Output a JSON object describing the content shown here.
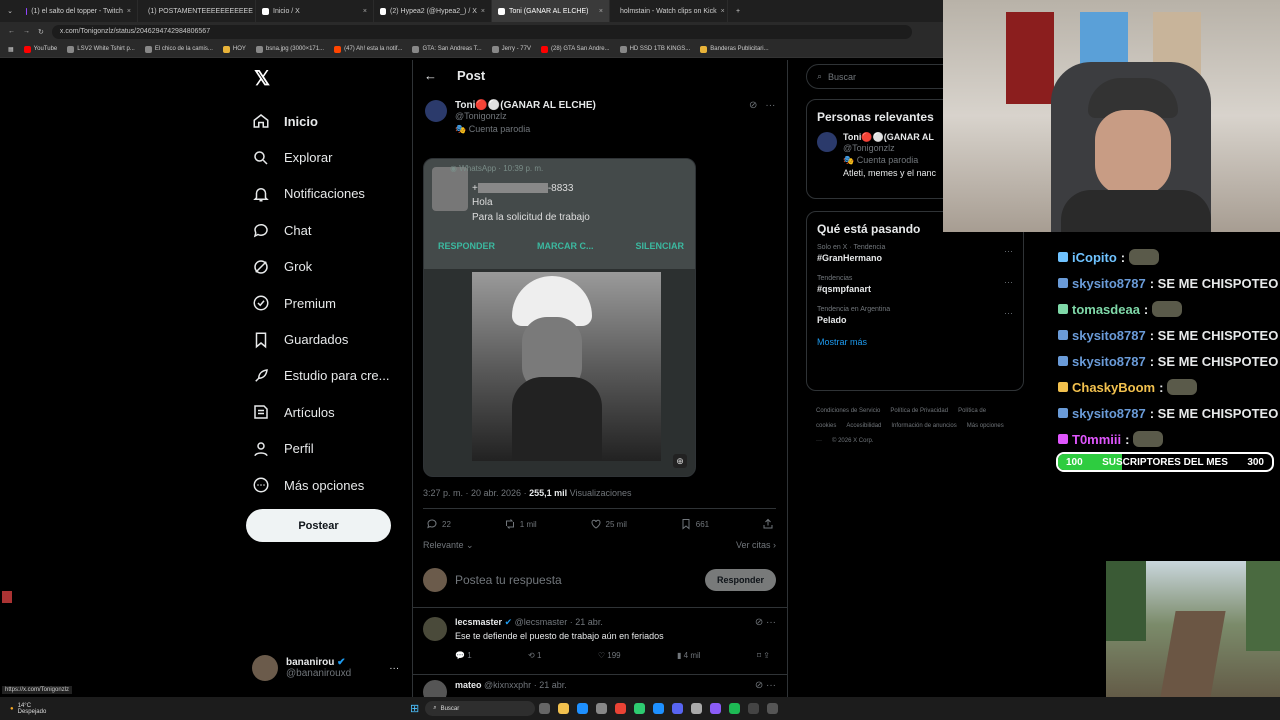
{
  "browser": {
    "tabs": [
      {
        "label": "(1) el salto del topper - Twitch",
        "color": "#9146ff"
      },
      {
        "label": "(1) POSTAMENTEEEEEEEEEEE",
        "color": "#9146ff"
      },
      {
        "label": "Inicio / X",
        "color": "#ffffff"
      },
      {
        "label": "(2) Hypea2 (@Hypea2_) / X",
        "color": "#ffffff"
      },
      {
        "label": "Toni (GANAR AL ELCHE)",
        "color": "#ffffff",
        "active": true
      },
      {
        "label": "holmstain - Watch clips on Kick",
        "color": "#53fc18"
      }
    ],
    "new_tab": "+",
    "url": "x.com/Tonigonzlz/status/2046294742984806567",
    "bookmarks": [
      {
        "label": "YouTube",
        "color": "#ff0000"
      },
      {
        "label": "LSV2 White Tshirt p...",
        "color": "#888888"
      },
      {
        "label": "El chico de la camis...",
        "color": "#888888"
      },
      {
        "label": "HOY",
        "color": "#e8b339"
      },
      {
        "label": "bsna.jpg (3000×171...",
        "color": "#888888"
      },
      {
        "label": "(47) Ah! esta la notif...",
        "color": "#ff4500"
      },
      {
        "label": "GTA: San Andreas T...",
        "color": "#888888"
      },
      {
        "label": "Jerry - 77V",
        "color": "#888888"
      },
      {
        "label": "(28) GTA San Andre...",
        "color": "#ff0000"
      },
      {
        "label": "HD SSD 1TB KINGS...",
        "color": "#888888"
      },
      {
        "label": "Banderas Publicitari...",
        "color": "#e8b339"
      }
    ]
  },
  "nav": {
    "items": [
      {
        "label": "Inicio",
        "icon": "home-icon",
        "bold": true
      },
      {
        "label": "Explorar",
        "icon": "search-icon"
      },
      {
        "label": "Notificaciones",
        "icon": "bell-icon"
      },
      {
        "label": "Chat",
        "icon": "chat-icon"
      },
      {
        "label": "Grok",
        "icon": "grok-icon"
      },
      {
        "label": "Premium",
        "icon": "premium-icon"
      },
      {
        "label": "Guardados",
        "icon": "bookmark-icon"
      },
      {
        "label": "Estudio para cre...",
        "icon": "rocket-icon"
      },
      {
        "label": "Artículos",
        "icon": "article-icon"
      },
      {
        "label": "Perfil",
        "icon": "person-icon"
      },
      {
        "label": "Más opciones",
        "icon": "more-icon"
      }
    ],
    "post_button": "Postear",
    "account": {
      "name": "bananirou",
      "handle": "@bananirouxd"
    }
  },
  "post": {
    "header_title": "Post",
    "author_name": "Toni🔴⚪(GANAR AL ELCHE)",
    "author_handle": "@Tonigonzlz",
    "parody_label": "Cuenta parodia",
    "media": {
      "app": "WhatsApp",
      "time": "10:39 p. m.",
      "phone_suffix": "-8833",
      "message_line1": "Hola",
      "message_line2": "Para la solicitud de trabajo",
      "btn_reply": "RESPONDER",
      "btn_mark": "MARCAR C...",
      "btn_silence": "SILENCIAR"
    },
    "timestamp": "3:27 p. m. · 20 abr. 2026 ·",
    "views_count": "255,1 mil",
    "views_label": "Visualizaciones",
    "replies": "22",
    "reposts": "1 mil",
    "likes": "25 mil",
    "bookmarks": "661",
    "sort_label": "Relevante",
    "quotes_link": "Ver citas",
    "reply_placeholder": "Postea tu respuesta",
    "reply_button": "Responder"
  },
  "replies": [
    {
      "name": "lecsmaster",
      "verified": true,
      "handle": "@lecsmaster",
      "date": "· 21 abr.",
      "text": "Ese te defiende el puesto de trabajo aún en feriados",
      "replies": "1",
      "reposts": "1",
      "likes": "199",
      "views": "4 mil"
    },
    {
      "name": "mateo",
      "verified": false,
      "handle": "@kixnxxphr",
      "date": "· 21 abr.",
      "text": ""
    }
  ],
  "sidebar": {
    "search_placeholder": "Buscar",
    "relevant_title": "Personas relevantes",
    "relevant_name": "Toni🔴⚪(GANAR AL",
    "relevant_handle": "@Tonigonzlz",
    "relevant_parody": "Cuenta parodia",
    "relevant_bio": "Atleti, memes y el nanc",
    "trends_title": "Qué está pasando",
    "trends": [
      {
        "meta": "Solo en X · Tendencia",
        "title": "#GranHermano"
      },
      {
        "meta": "Tendencias",
        "title": "#qsmpfanart"
      },
      {
        "meta": "Tendencia en Argentina",
        "title": "Pelado"
      }
    ],
    "show_more": "Mostrar más",
    "footer": [
      "Condiciones de Servicio",
      "Política de Privacidad",
      "Política de cookies",
      "Accesibilidad",
      "Información de anuncios",
      "Más opciones ···",
      "© 2026 X Corp."
    ]
  },
  "stream": {
    "chat": [
      {
        "user": "iCopito",
        "text": ":",
        "color": "#6fc3ff",
        "emote": true
      },
      {
        "user": "skysito8787",
        "text": ": SE ME CHISPOTEO",
        "color": "#6a9bd8"
      },
      {
        "user": "tomasdeaa",
        "text": ":",
        "color": "#7fd8a8",
        "emote": true
      },
      {
        "user": "skysito8787",
        "text": ": SE ME CHISPOTEO",
        "color": "#6a9bd8"
      },
      {
        "user": "skysito8787",
        "text": ": SE ME CHISPOTEO",
        "color": "#6a9bd8"
      },
      {
        "user": "ChaskyBoom",
        "text": ":",
        "color": "#f2c14e",
        "emote": true
      },
      {
        "user": "skysito8787",
        "text": ": SE ME CHISPOTEO",
        "color": "#6a9bd8"
      },
      {
        "user": "T0mmiii",
        "text": ":",
        "color": "#e056fd",
        "emote": true
      }
    ],
    "sub_goal": {
      "start": "100",
      "label": "SUSCRIPTORES DEL MES",
      "end": "300",
      "progress": 0.3
    }
  },
  "taskbar": {
    "weather_temp": "14°C",
    "weather_text": "Despejado",
    "search": "Buscar",
    "status_url": "https://x.com/Tonigonzlz"
  }
}
